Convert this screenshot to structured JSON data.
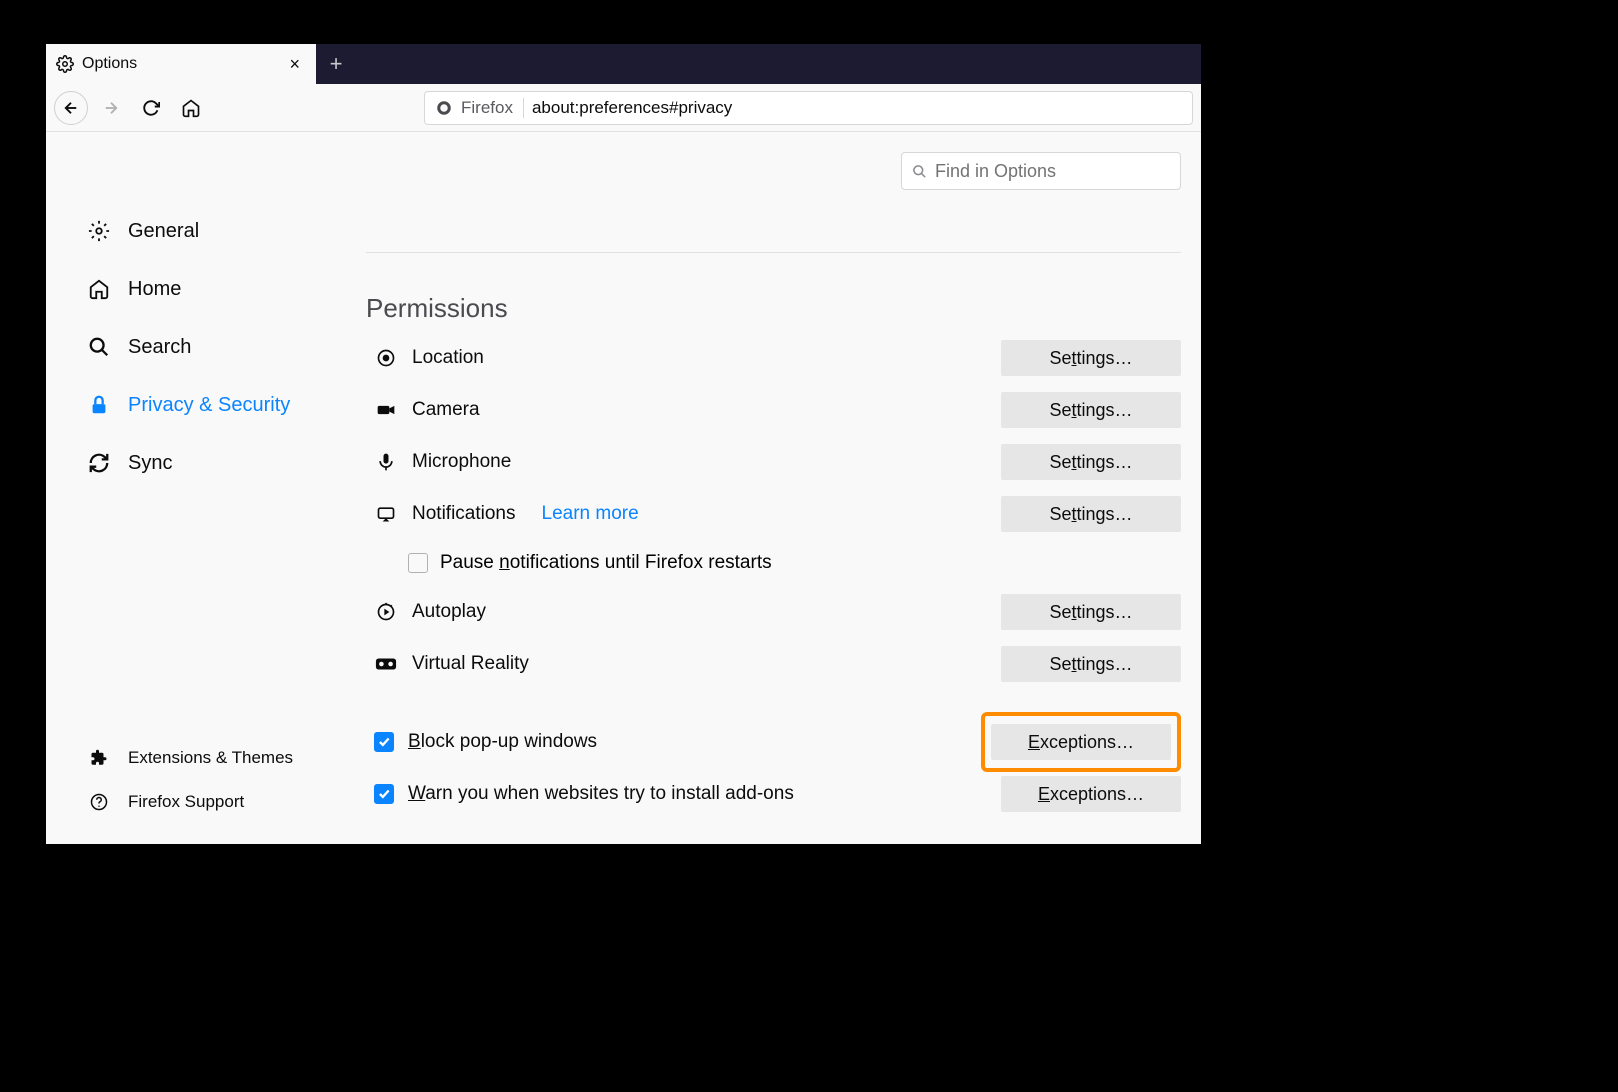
{
  "tab": {
    "title": "Options"
  },
  "urlbar": {
    "identity": "Firefox",
    "address": "about:preferences#privacy"
  },
  "search": {
    "placeholder": "Find in Options"
  },
  "sidebar": {
    "items": [
      {
        "label": "General"
      },
      {
        "label": "Home"
      },
      {
        "label": "Search"
      },
      {
        "label": "Privacy & Security"
      },
      {
        "label": "Sync"
      }
    ],
    "bottom": [
      {
        "label": "Extensions & Themes"
      },
      {
        "label": "Firefox Support"
      }
    ]
  },
  "section_title": "Permissions",
  "permissions": {
    "location": {
      "label": "Location",
      "button": "Settings…"
    },
    "camera": {
      "label": "Camera",
      "button": "Settings…"
    },
    "microphone": {
      "label": "Microphone",
      "button": "Settings…"
    },
    "notifications": {
      "label": "Notifications",
      "learn_more": "Learn more",
      "button": "Settings…",
      "pause_label": "Pause notifications until Firefox restarts"
    },
    "autoplay": {
      "label": "Autoplay",
      "button": "Settings…"
    },
    "vr": {
      "label": "Virtual Reality",
      "button": "Settings…"
    }
  },
  "checkboxes": {
    "block_popups": {
      "label": "Block pop-up windows",
      "button": "Exceptions…",
      "checked": true
    },
    "warn_addons": {
      "label": "Warn you when websites try to install add-ons",
      "button": "Exceptions…",
      "checked": true
    }
  }
}
